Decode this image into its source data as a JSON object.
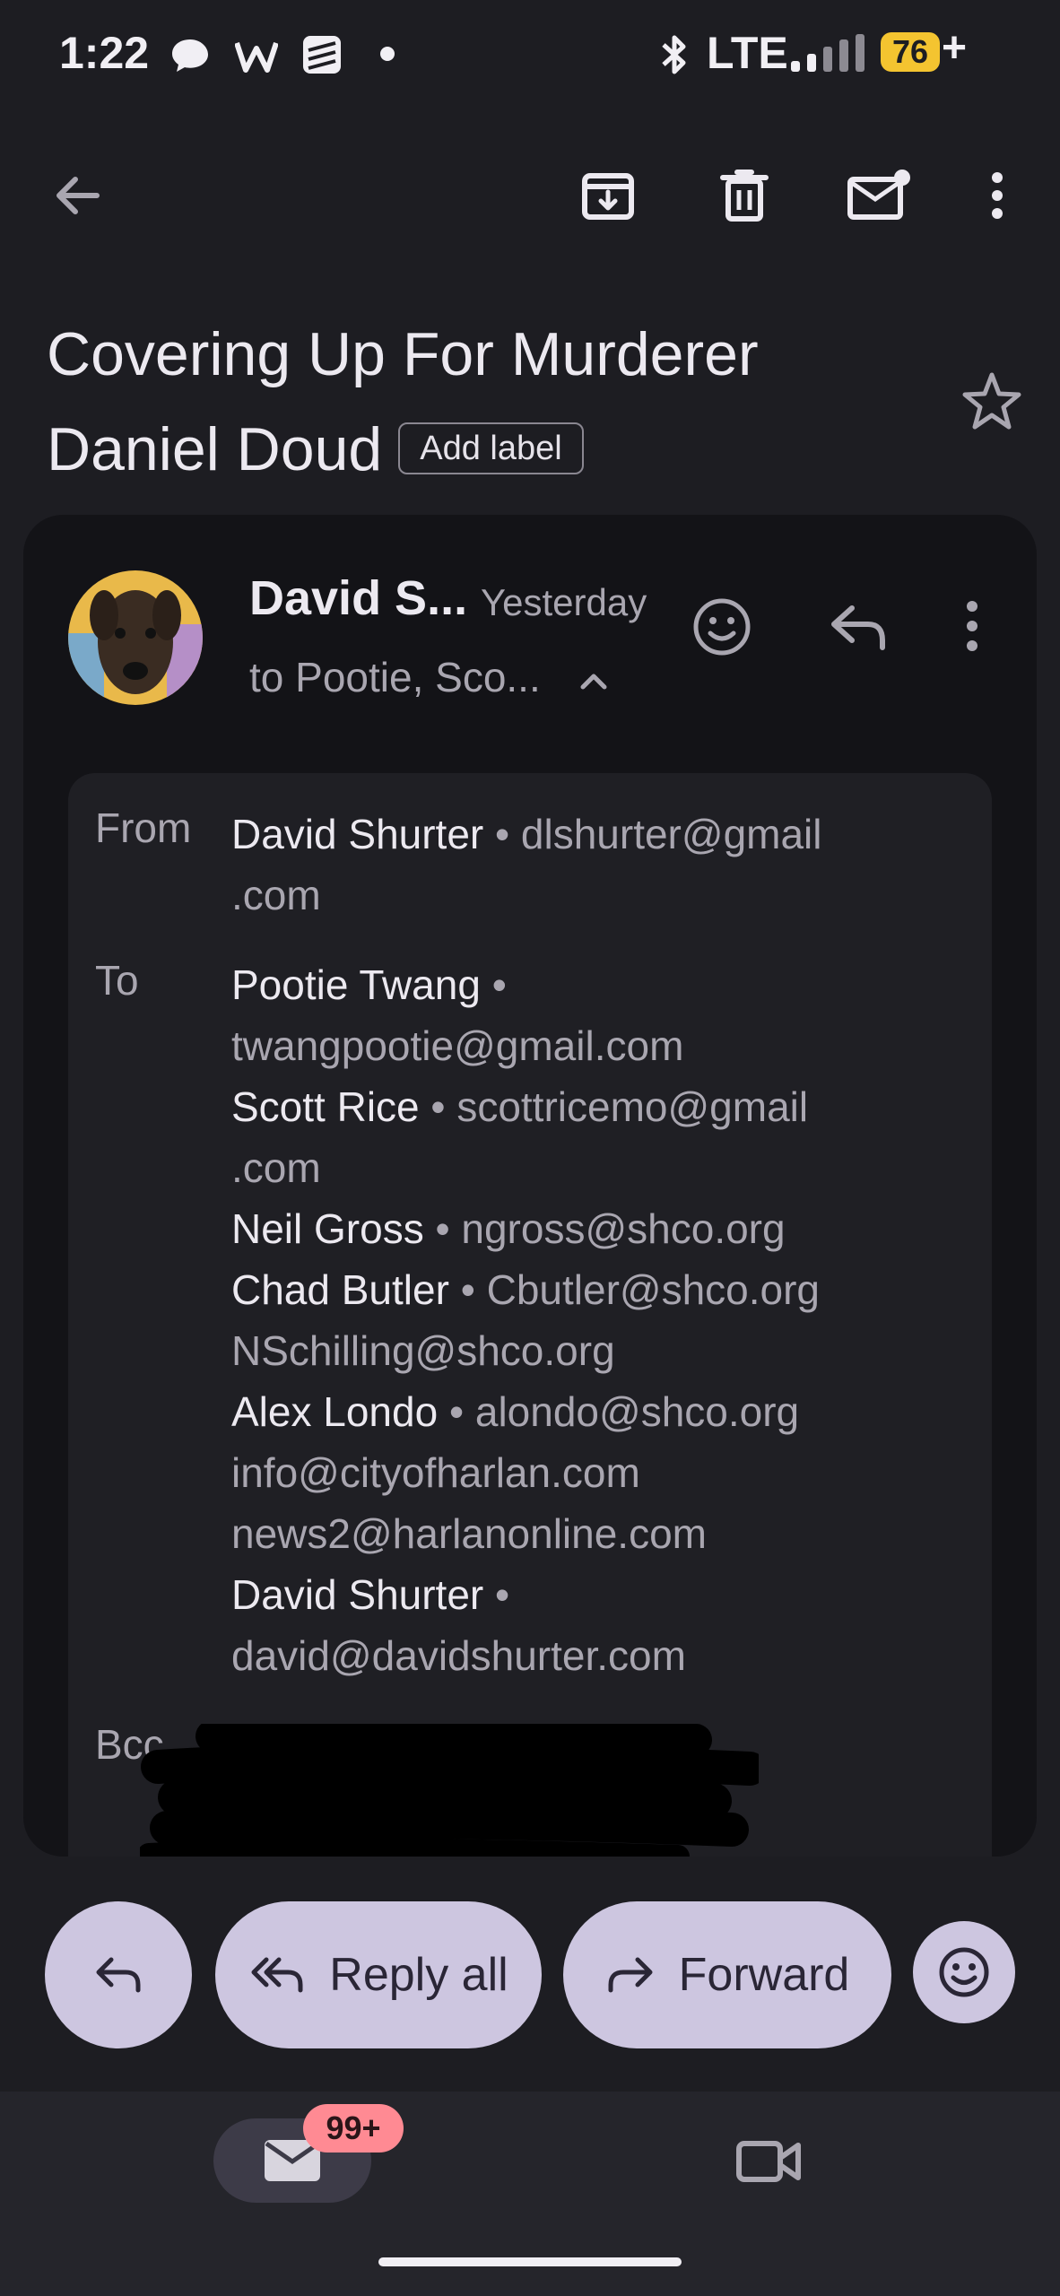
{
  "status_bar": {
    "time": "1:22",
    "network": "LTE",
    "battery": "76",
    "charging": "+"
  },
  "toolbar": {
    "icons": [
      "back-arrow-icon",
      "archive-icon",
      "delete-icon",
      "mark-unread-icon",
      "more-vert-icon"
    ]
  },
  "email": {
    "subject": "Covering Up For Murderer Daniel Doud",
    "add_label": "Add label",
    "sender_short": "David S...",
    "time": "Yesterday",
    "recipients_short": "to Pootie, Sco...",
    "details": {
      "from_label": "From",
      "from": {
        "name": "David Shurter",
        "email": "dlshurter@gmail.com"
      },
      "to_label": "To",
      "to_line1_name": "Pootie Twang",
      "to_line2_email": "twangpootie@gmail.com",
      "to_line3_name": "Scott Rice",
      "to_line3_email": "scottricemo@gmail",
      "to_line4_email": ".com",
      "to_line5_name": "Neil Gross",
      "to_line5_email": "ngross@shco.org",
      "to_line6_name": "Chad Butler",
      "to_line6_email": "Cbutler@shco.org",
      "to_line7_email": "NSchilling@shco.org",
      "to_line8_name": "Alex Londo",
      "to_line8_email": "alondo@shco.org",
      "to_line9_email": "info@cityofharlan.com",
      "to_line10_email": "news2@harlanonline.com",
      "to_line11_name": "David Shurter",
      "to_line12_email": "david@davidshurter.com",
      "bcc_label": "Bcc",
      "from_line1_email": "dlshurter@gmail",
      "from_line2_email": ".com"
    }
  },
  "actions": {
    "reply_all": "Reply all",
    "forward": "Forward"
  },
  "nav": {
    "badge": "99+"
  },
  "colors": {
    "background": "#1d1d22",
    "card": "#131317",
    "pill": "#cdc6e0",
    "badge": "#ff8a93",
    "battery": "#f4c430"
  }
}
